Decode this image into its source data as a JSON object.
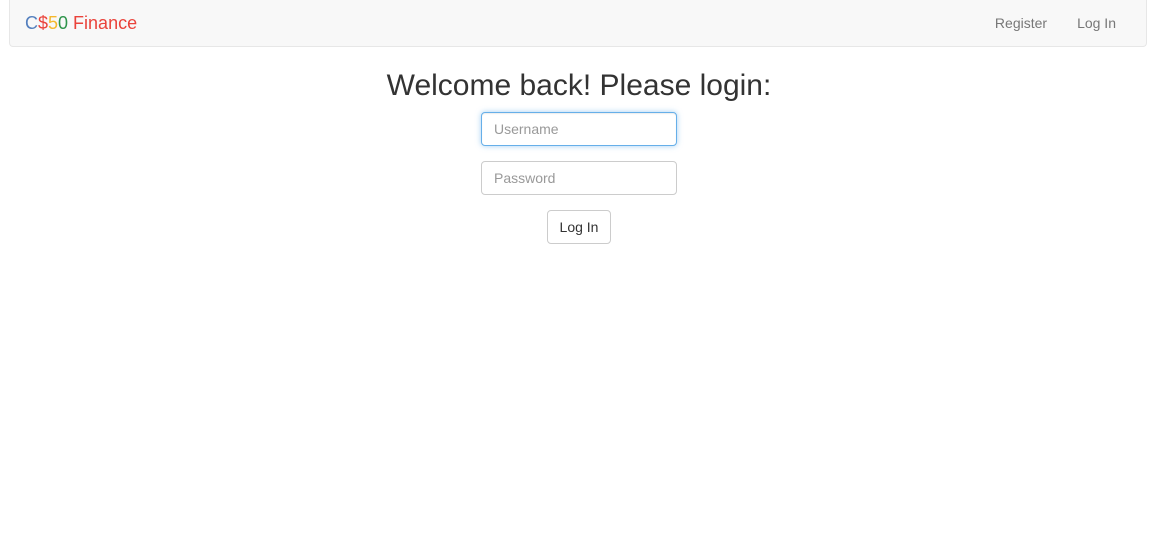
{
  "navbar": {
    "brand": {
      "parts": [
        "C",
        "$",
        "5",
        "0",
        " Finance"
      ],
      "colors": [
        "#537fbe",
        "#ea433b",
        "#f5b82e",
        "#2e944b",
        "#ea433b"
      ]
    },
    "links": {
      "register": "Register",
      "login": "Log In"
    }
  },
  "login_form": {
    "title": "Welcome back! Please login:",
    "username_placeholder": "Username",
    "password_placeholder": "Password",
    "submit_label": "Log In"
  }
}
